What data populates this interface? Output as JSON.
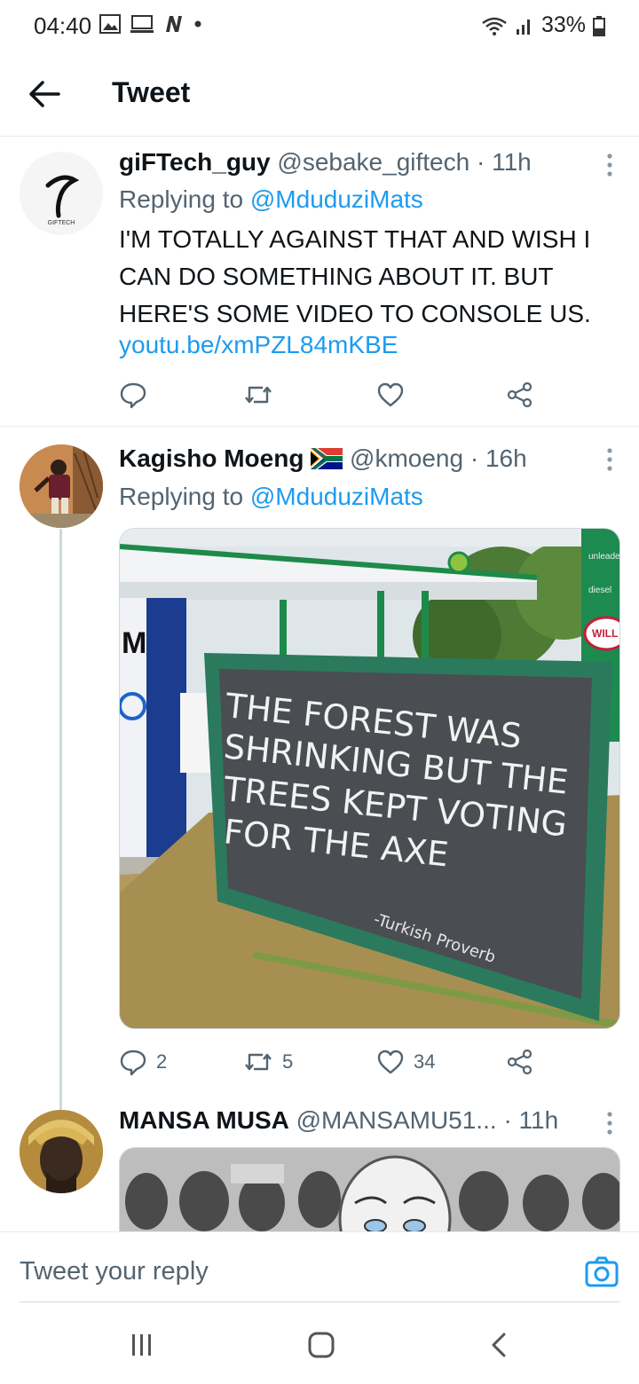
{
  "status_bar": {
    "time": "04:40",
    "battery": "33%"
  },
  "header": {
    "title": "Tweet"
  },
  "tweets": [
    {
      "display_name": "giFTech_guy",
      "handle": "@sebake_giftech",
      "time": "· 11h",
      "replying_prefix": "Replying to",
      "replying_to": "@MduduziMats",
      "text": "I'M TOTALLY AGAINST THAT AND WISH I CAN DO SOMETHING ABOUT IT. BUT HERE'S SOME VIDEO TO CONSOLE US.",
      "link": "youtu.be/xmPZL84mKBE",
      "avatar_text": "GIFTECH"
    },
    {
      "display_name": "Kagisho Moeng",
      "handle": "@kmoeng",
      "time": "· 16h",
      "replying_prefix": "Replying to",
      "replying_to": "@MduduziMats",
      "image": {
        "sign_lines": [
          "THE FOREST WAS",
          "SHRINKING BUT THE",
          "TREES KEPT VOTING",
          "FOR THE AXE"
        ],
        "sign_attribution": "-Turkish Proverb",
        "station_labels": [
          "unleaded",
          "diesel",
          "WILL"
        ],
        "pillar_letter": "M"
      },
      "reply_count": "2",
      "retweet_count": "5",
      "like_count": "34"
    },
    {
      "display_name": "MANSA MUSA",
      "handle": "@MANSAMU51...",
      "time": "· 11h"
    }
  ],
  "reply_bar": {
    "placeholder": "Tweet your reply"
  },
  "colors": {
    "accent": "#1d9bf0",
    "text": "#0f1419",
    "muted": "#536471"
  }
}
